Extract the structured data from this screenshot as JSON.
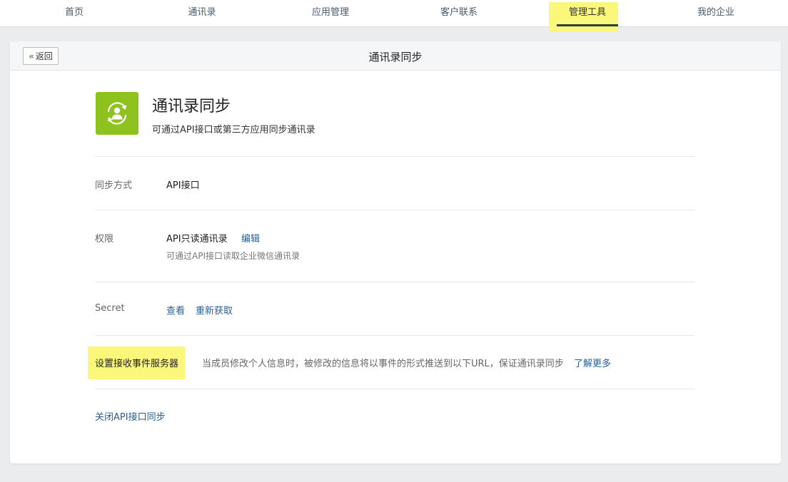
{
  "topnav": {
    "items": [
      {
        "label": "首页"
      },
      {
        "label": "通讯录"
      },
      {
        "label": "应用管理"
      },
      {
        "label": "客户联系"
      },
      {
        "label": "管理工具"
      },
      {
        "label": "我的企业"
      }
    ],
    "active_index": 4
  },
  "header": {
    "back_label": "返回",
    "title": "通讯录同步"
  },
  "app": {
    "name": "通讯录同步",
    "description": "可通过API接口或第三方应用同步通讯录",
    "icon": "contact-sync-icon",
    "icon_color": "#8dc21f"
  },
  "sync_method": {
    "label": "同步方式",
    "value": "API接口"
  },
  "permission": {
    "label": "权限",
    "value": "API只读通讯录",
    "edit_label": "编辑",
    "note": "可通过API接口读取企业微信通讯录"
  },
  "secret": {
    "label": "Secret",
    "view_label": "查看",
    "refresh_label": "重新获取"
  },
  "event_server": {
    "label": "设置接收事件服务器",
    "description": "当成员修改个人信息时，被修改的信息将以事件的形式推送到以下URL，保证通讯录同步",
    "learn_more_label": "了解更多"
  },
  "disable_label": "关闭API接口同步",
  "colors": {
    "highlight": "#fbf77a",
    "link": "#295e94",
    "active_underline": "#24423a"
  }
}
